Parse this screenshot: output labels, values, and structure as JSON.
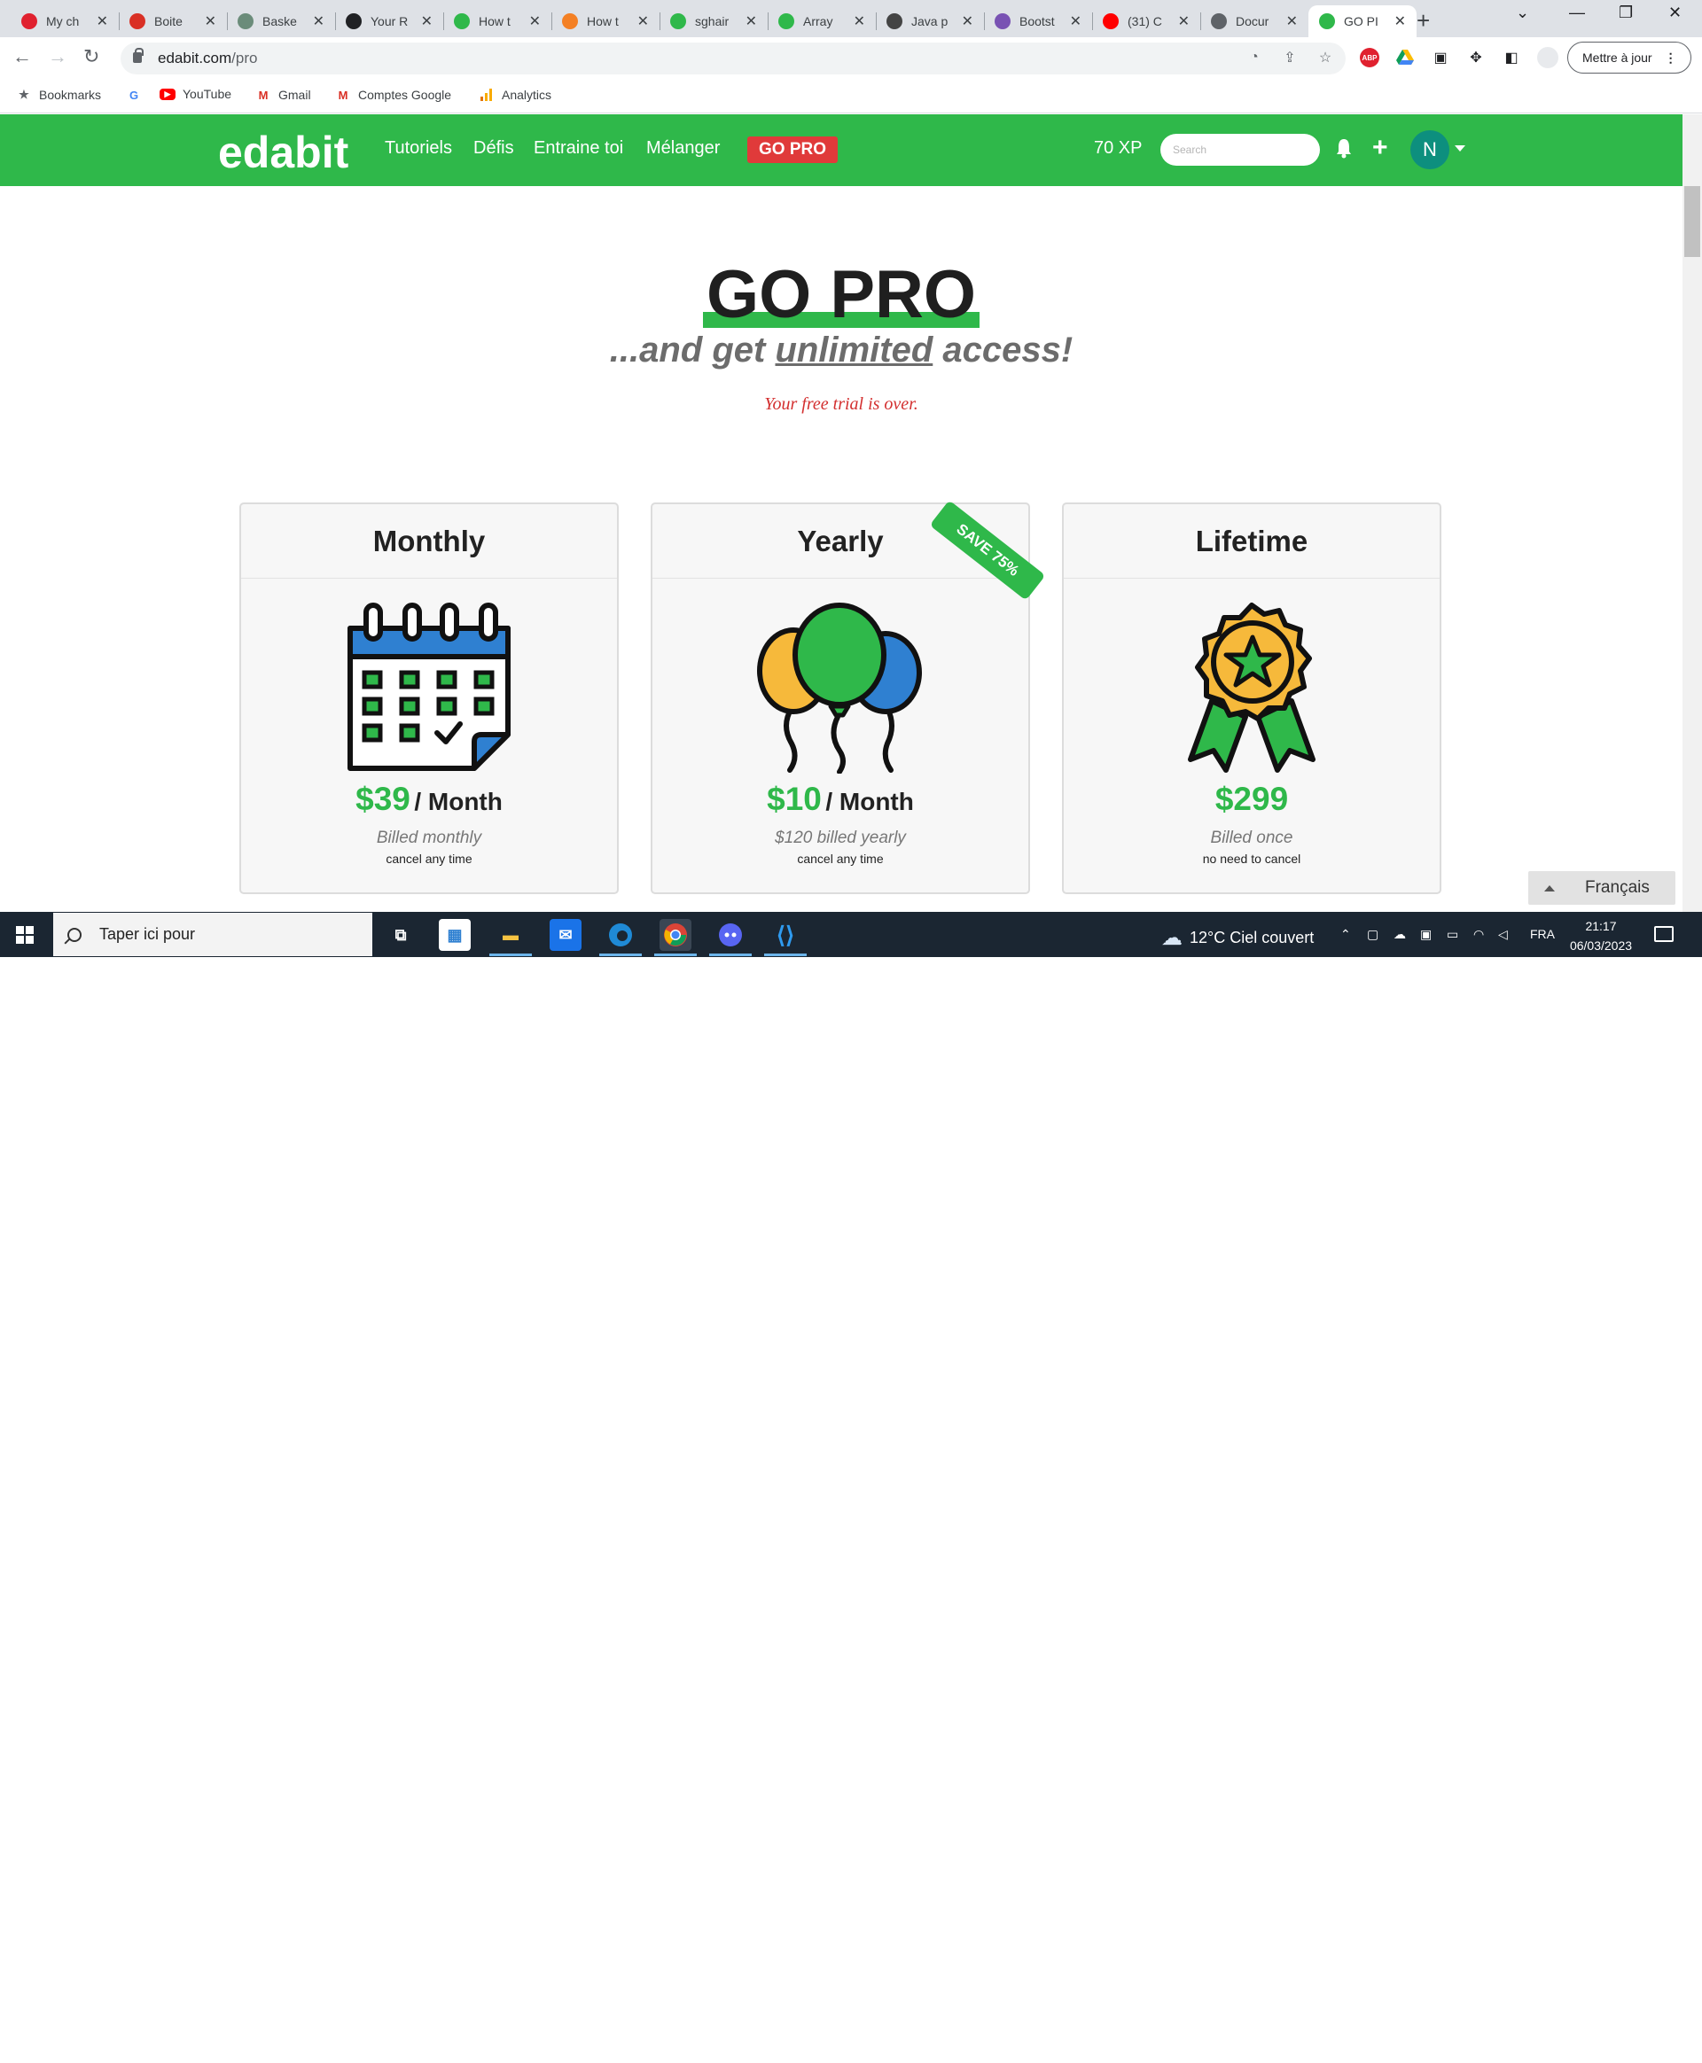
{
  "browser": {
    "tabs": [
      {
        "title": "My ch",
        "icon": "opera-icon",
        "color": "#e0212f"
      },
      {
        "title": "Boite",
        "icon": "gmail-icon",
        "color": "#d93025"
      },
      {
        "title": "Baske",
        "icon": "chatgpt-icon",
        "color": "#6b8c7a"
      },
      {
        "title": "Your R",
        "icon": "github-icon",
        "color": "#202124"
      },
      {
        "title": "How t",
        "icon": "edabit-icon",
        "color": "#2fb84a"
      },
      {
        "title": "How t",
        "icon": "stackoverflow-icon",
        "color": "#f48024"
      },
      {
        "title": "sghair",
        "icon": "edabit-icon",
        "color": "#2fb84a"
      },
      {
        "title": "Array",
        "icon": "edabit-icon",
        "color": "#2fb84a"
      },
      {
        "title": "Java p",
        "icon": "diamond-icon",
        "color": "#444444"
      },
      {
        "title": "Bootst",
        "icon": "bootstrap-icon",
        "color": "#7952b3"
      },
      {
        "title": "(31) C",
        "icon": "youtube-icon",
        "color": "#ff0000"
      },
      {
        "title": "Docur",
        "icon": "globe-icon",
        "color": "#5f6368"
      },
      {
        "title": "GO PI",
        "icon": "edabit-icon",
        "color": "#2fb84a"
      }
    ],
    "url_host": "edabit.com",
    "url_path": "/pro",
    "update_button": "Mettre à jour",
    "bookmarks": [
      {
        "label": "Bookmarks",
        "icon": "star-icon"
      },
      {
        "label": "",
        "icon": "google-icon"
      },
      {
        "label": "YouTube",
        "icon": "youtube-icon"
      },
      {
        "label": "Gmail",
        "icon": "gmail-icon"
      },
      {
        "label": "Comptes Google",
        "icon": "gmail-icon"
      },
      {
        "label": "Analytics",
        "icon": "analytics-icon"
      }
    ]
  },
  "site": {
    "logo": "edabit",
    "nav": [
      "Tutoriels",
      "Défis",
      "Entraine toi",
      "Mélanger"
    ],
    "go_pro": "GO PRO",
    "xp": "70 XP",
    "search_placeholder": "Search",
    "avatar_initial": "N",
    "brand_color": "#2fb84a"
  },
  "hero": {
    "title": "GO PRO",
    "subtitle_pre": "...and get ",
    "subtitle_em": "unlimited",
    "subtitle_post": " access!",
    "trial": "Your free trial is over."
  },
  "plans": [
    {
      "name": "Monthly",
      "price": "$39",
      "period": "/ Month",
      "billed": "Billed monthly",
      "note": "cancel any time",
      "icon": "calendar-icon"
    },
    {
      "name": "Yearly",
      "price": "$10",
      "period": "/ Month",
      "billed": "$120 billed yearly",
      "note": "cancel any time",
      "icon": "balloons-icon",
      "ribbon": "SAVE 75%"
    },
    {
      "name": "Lifetime",
      "price": "$299",
      "period": "",
      "billed": "Billed once",
      "note": "no need to cancel",
      "icon": "award-badge-icon"
    }
  ],
  "language": "Français",
  "taskbar": {
    "search_placeholder": "Taper ici pour",
    "weather": "12°C  Ciel couvert",
    "lang": "FRA",
    "time": "21:17",
    "date": "06/03/2023"
  }
}
